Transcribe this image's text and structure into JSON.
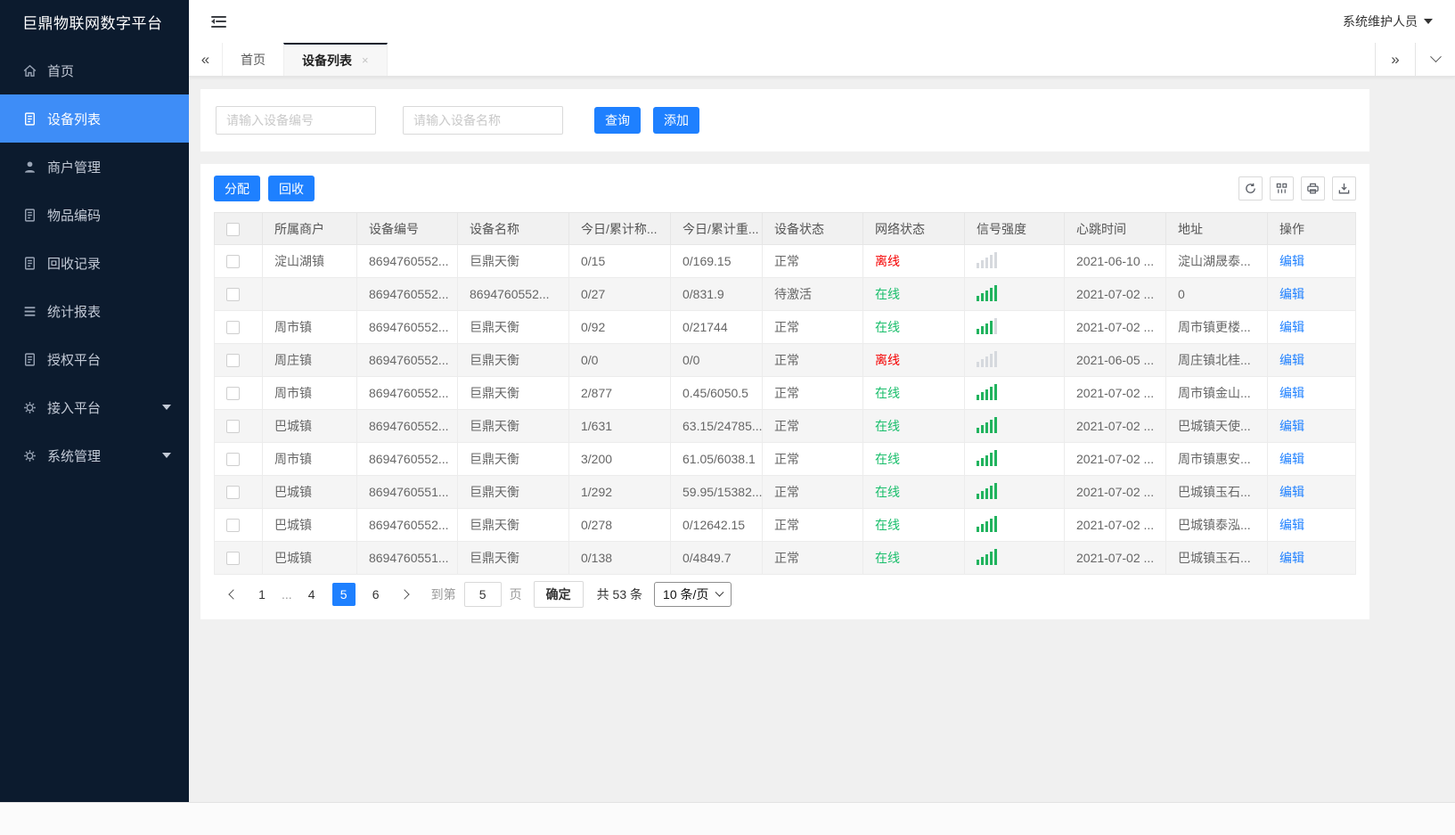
{
  "app": {
    "title": "巨鼎物联网数字平台",
    "user_menu": "系统维护人员"
  },
  "sidebar": {
    "items": [
      {
        "icon": "home-icon",
        "label": "首页",
        "active": false,
        "caret": false
      },
      {
        "icon": "document-icon",
        "label": "设备列表",
        "active": true,
        "caret": false
      },
      {
        "icon": "user-icon",
        "label": "商户管理",
        "active": false,
        "caret": false
      },
      {
        "icon": "document-icon",
        "label": "物品编码",
        "active": false,
        "caret": false
      },
      {
        "icon": "document-icon",
        "label": "回收记录",
        "active": false,
        "caret": false
      },
      {
        "icon": "list-icon",
        "label": "统计报表",
        "active": false,
        "caret": false
      },
      {
        "icon": "document-icon",
        "label": "授权平台",
        "active": false,
        "caret": false
      },
      {
        "icon": "gear-icon",
        "label": "接入平台",
        "active": false,
        "caret": true
      },
      {
        "icon": "gear-icon",
        "label": "系统管理",
        "active": false,
        "caret": true
      }
    ]
  },
  "tabbar": {
    "tabs": [
      {
        "label": "首页",
        "active": false
      },
      {
        "label": "设备列表",
        "active": true,
        "close": "×"
      }
    ]
  },
  "search": {
    "fields": [
      {
        "placeholder": "请输入设备编号"
      },
      {
        "placeholder": "请输入设备名称"
      }
    ],
    "query_label": "查询",
    "add_label": "添加"
  },
  "table_toolbar": {
    "assign_label": "分配",
    "recycle_label": "回收",
    "icon_buttons": [
      "refresh-icon",
      "column-filter-icon",
      "print-icon",
      "export-icon"
    ]
  },
  "table": {
    "columns": [
      "所属商户",
      "设备编号",
      "设备名称",
      "今日/累计称...",
      "今日/累计重...",
      "设备状态",
      "网络状态",
      "信号强度",
      "心跳时间",
      "地址",
      "操作"
    ],
    "online_label": "在线",
    "offline_label": "离线",
    "edit_label": "编辑",
    "rows": [
      {
        "merchant": "淀山湖镇",
        "device_no": "8694760552...",
        "device_name": "巨鼎天衡",
        "count": "0/15",
        "weight": "0/169.15",
        "status": "正常",
        "network": "offline",
        "signal": 0,
        "heartbeat": "2021-06-10 ...",
        "address": "淀山湖晟泰..."
      },
      {
        "merchant": "",
        "device_no": "8694760552...",
        "device_name": "8694760552...",
        "count": "0/27",
        "weight": "0/831.9",
        "status": "待激活",
        "network": "online",
        "signal": 5,
        "heartbeat": "2021-07-02 ...",
        "address": "0"
      },
      {
        "merchant": "周市镇",
        "device_no": "8694760552...",
        "device_name": "巨鼎天衡",
        "count": "0/92",
        "weight": "0/21744",
        "status": "正常",
        "network": "online",
        "signal": 4,
        "heartbeat": "2021-07-02 ...",
        "address": "周市镇更楼..."
      },
      {
        "merchant": "周庄镇",
        "device_no": "8694760552...",
        "device_name": "巨鼎天衡",
        "count": "0/0",
        "weight": "0/0",
        "status": "正常",
        "network": "offline",
        "signal": 0,
        "heartbeat": "2021-06-05 ...",
        "address": "周庄镇北桂..."
      },
      {
        "merchant": "周市镇",
        "device_no": "8694760552...",
        "device_name": "巨鼎天衡",
        "count": "2/877",
        "weight": "0.45/6050.5",
        "status": "正常",
        "network": "online",
        "signal": 5,
        "heartbeat": "2021-07-02 ...",
        "address": "周市镇金山..."
      },
      {
        "merchant": "巴城镇",
        "device_no": "8694760552...",
        "device_name": "巨鼎天衡",
        "count": "1/631",
        "weight": "63.15/24785...",
        "status": "正常",
        "network": "online",
        "signal": 5,
        "heartbeat": "2021-07-02 ...",
        "address": "巴城镇天使..."
      },
      {
        "merchant": "周市镇",
        "device_no": "8694760552...",
        "device_name": "巨鼎天衡",
        "count": "3/200",
        "weight": "61.05/6038.1",
        "status": "正常",
        "network": "online",
        "signal": 5,
        "heartbeat": "2021-07-02 ...",
        "address": "周市镇惠安..."
      },
      {
        "merchant": "巴城镇",
        "device_no": "8694760551...",
        "device_name": "巨鼎天衡",
        "count": "1/292",
        "weight": "59.95/15382...",
        "status": "正常",
        "network": "online",
        "signal": 5,
        "heartbeat": "2021-07-02 ...",
        "address": "巴城镇玉石..."
      },
      {
        "merchant": "巴城镇",
        "device_no": "8694760552...",
        "device_name": "巨鼎天衡",
        "count": "0/278",
        "weight": "0/12642.15",
        "status": "正常",
        "network": "online",
        "signal": 5,
        "heartbeat": "2021-07-02 ...",
        "address": "巴城镇泰泓..."
      },
      {
        "merchant": "巴城镇",
        "device_no": "8694760551...",
        "device_name": "巨鼎天衡",
        "count": "0/138",
        "weight": "0/4849.7",
        "status": "正常",
        "network": "online",
        "signal": 5,
        "heartbeat": "2021-07-02 ...",
        "address": "巴城镇玉石..."
      }
    ]
  },
  "pagination": {
    "pages": [
      "1",
      "...",
      "4",
      "5",
      "6"
    ],
    "active_page": "5",
    "goto_label": "到第",
    "goto_value": "5",
    "page_unit_label": "页",
    "confirm_label": "确定",
    "total_label": "共 53 条",
    "page_size_label": "10 条/页"
  },
  "colors": {
    "primary": "#1e80ff",
    "sidebar_bg": "#0c1b2e",
    "sidebar_active": "#3e8df7",
    "online_green": "#19be6b",
    "offline_red": "#f50000",
    "content_bg": "#f0f0f0"
  }
}
